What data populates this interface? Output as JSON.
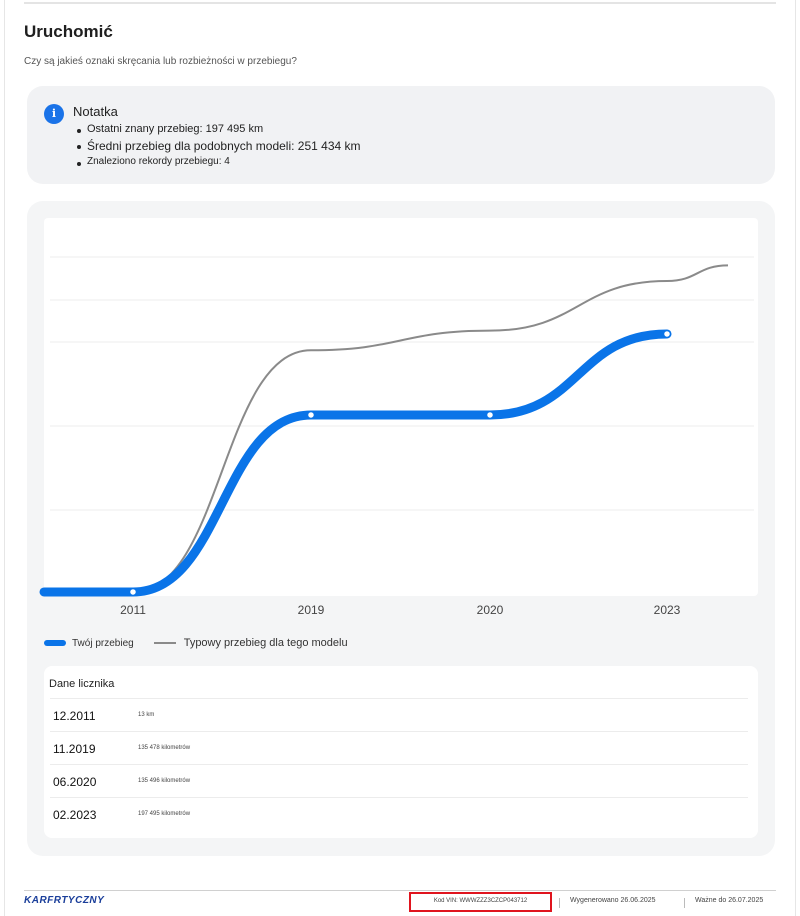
{
  "section": {
    "title": "Uruchomić",
    "question": "Czy są jakieś oznaki skręcania lub rozbieżności w przebiegu?"
  },
  "note": {
    "icon": "info-icon",
    "icon_glyph": "i",
    "title": "Notatka",
    "items": [
      "Ostatni znany przebieg: 197 495 km",
      "Średni przebieg dla podobnych modeli: 251 434 km",
      "Znaleziono rekordy przebiegu: 4"
    ]
  },
  "chart_data": {
    "type": "line",
    "categories": [
      "2011",
      "2019",
      "2020",
      "2023"
    ],
    "ylim": [
      0,
      300000
    ],
    "series": [
      {
        "name": "Twój przebieg",
        "color": "#0a74e8",
        "values": [
          13,
          135478,
          135496,
          197495
        ]
      },
      {
        "name": "Typowy przebieg dla tego modelu",
        "color": "#8a8a8a",
        "values": [
          13,
          185000,
          200000,
          238000
        ]
      }
    ],
    "grid": true,
    "legend": "bottom-left"
  },
  "readings": {
    "title": "Dane licznika",
    "rows": [
      {
        "date": "12.2011",
        "km": "13 km"
      },
      {
        "date": "11.2019",
        "km": "135 478 kilometrów"
      },
      {
        "date": "06.2020",
        "km": "135 496 kilometrów"
      },
      {
        "date": "02.2023",
        "km": "197 495 kilometrów"
      }
    ]
  },
  "footer": {
    "logo": "KARFRTYCZNY",
    "vin": "Kod VIN: WWWZZZ3CZCP043712",
    "generated": "Wygenerowano 26.06.2025",
    "valid": "Ważne do 26.07.2025",
    "vin_highlight_color": "#e0141e"
  }
}
